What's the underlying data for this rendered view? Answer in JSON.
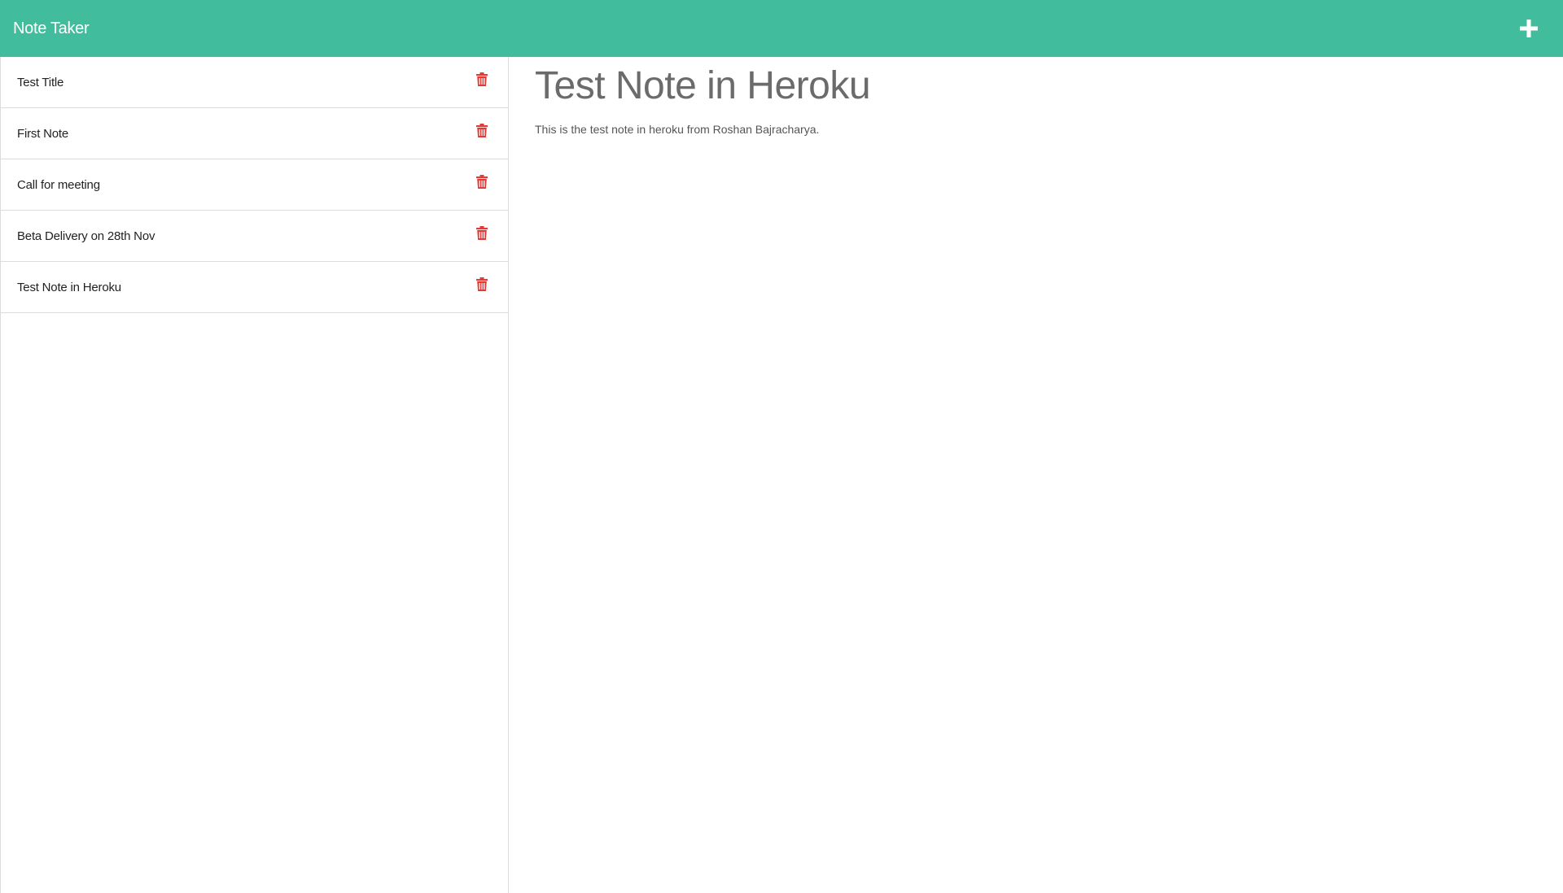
{
  "app": {
    "title": "Note Taker"
  },
  "toolbar": {
    "new_note_icon": "plus-icon"
  },
  "sidebar": {
    "notes": [
      {
        "title": "Test Title",
        "icon": "trash-icon"
      },
      {
        "title": "First Note",
        "icon": "trash-icon"
      },
      {
        "title": "Call for meeting",
        "icon": "trash-icon"
      },
      {
        "title": "Beta Delivery on 28th Nov",
        "icon": "trash-icon"
      },
      {
        "title": "Test Note in Heroku",
        "icon": "trash-icon"
      }
    ]
  },
  "active_note": {
    "title": "Test Note in Heroku",
    "text": "This is the test note in heroku from Roshan Bajracharya."
  },
  "colors": {
    "header": "#41bd9d",
    "delete": "#e53935",
    "heading_text": "#6b6b6b"
  }
}
